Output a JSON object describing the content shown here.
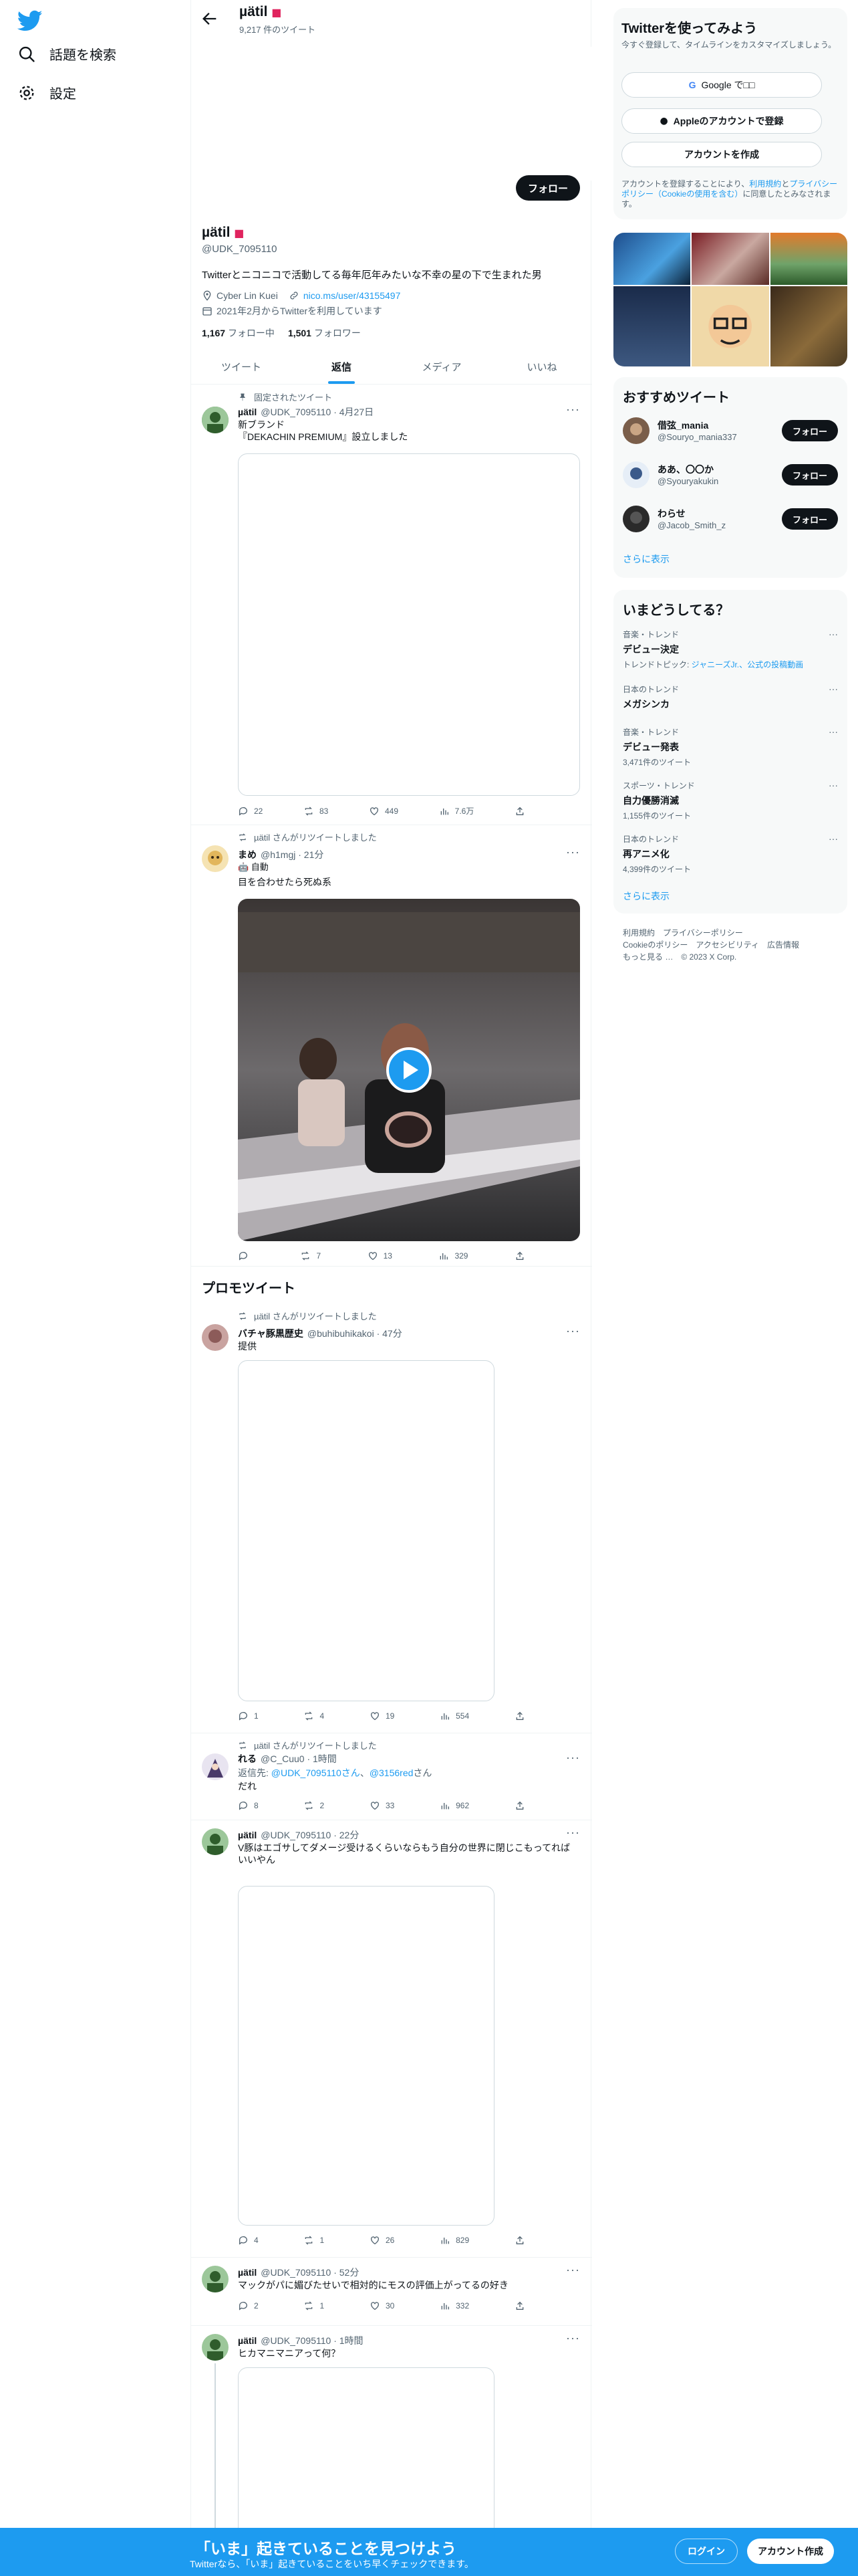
{
  "nav": {
    "logo_icon": "twitter-bird-icon",
    "items": [
      {
        "label": "話題を検索",
        "icon": "search-icon"
      },
      {
        "label": "設定",
        "icon": "gear-icon"
      }
    ]
  },
  "header": {
    "name": "µätil",
    "tweet_count": "9,217 件のツイート"
  },
  "profile": {
    "follow_label": "フォロー",
    "name": "µätil",
    "handle": "@UDK_7095110",
    "bio": "Twitterとニコニコで活動してる毎年厄年みたいな不幸の星の下で生まれた男",
    "location": "Cyber Lin Kuei",
    "url": "nico.ms/user/43155497",
    "joined": "2021年2月からTwitterを利用しています",
    "following_num": "1,167",
    "following_label": "フォロー中",
    "followers_num": "1,501",
    "followers_label": "フォロワー"
  },
  "tabs": [
    "ツイート",
    "返信",
    "メディア",
    "いいね"
  ],
  "tweets": [
    {
      "context": "固定されたツイート",
      "name": "µätil",
      "handle": "@UDK_7095110 · 4月27日",
      "text": "新ブランド\n『DEKACHIN PREMIUM』設立しました",
      "reply": "22",
      "rt": "83",
      "like": "449",
      "views": "7.6万"
    },
    {
      "context": "µätil さんがリツイートしました",
      "name": "まめ",
      "handle": "@h1mgj · 21分",
      "badge": "🤖 自動",
      "text": "目を合わせたら死ぬ系",
      "reply": "",
      "rt": "7",
      "like": "13",
      "views": "329"
    },
    {
      "context": "µätil さんがリツイートしました",
      "name": "バチャ豚黒歴史",
      "handle": "@buhibuhikakoi · 47分",
      "text": "提供",
      "reply": "1",
      "rt": "4",
      "like": "19",
      "views": "554"
    },
    {
      "context": "µätil さんがリツイートしました",
      "name": "れる",
      "handle": "@C_Cuu0 · 1時間",
      "reply_to_prefix": "返信先: ",
      "reply_to_a": "@UDK_7095110さん",
      "reply_to_mid": "、",
      "reply_to_b": "@3156red",
      "reply_to_suffix": "さん",
      "text": "だれ",
      "reply": "8",
      "rt": "2",
      "like": "33",
      "views": "962"
    },
    {
      "name": "µätil",
      "handle": "@UDK_7095110 · 22分",
      "text": "V豚はエゴサしてダメージ受けるくらいならもう自分の世界に閉じこもってればいいやん",
      "reply": "4",
      "rt": "1",
      "like": "26",
      "views": "829"
    },
    {
      "name": "µätil",
      "handle": "@UDK_7095110 · 52分",
      "text": "マックがパに媚びたせいで相対的にモスの評価上がってるの好き",
      "reply": "2",
      "rt": "1",
      "like": "30",
      "views": "332"
    },
    {
      "name": "µätil",
      "handle": "@UDK_7095110 · 1時間",
      "text": "ヒカマニマニアって何？"
    }
  ],
  "promo_heading": "プロモツイート",
  "right": {
    "signup": {
      "title": "Twitterを使ってみよう",
      "desc": "今すぐ登録して、タイムラインをカスタマイズしましょう。",
      "google": "Google で□□",
      "apple": "Appleのアカウントで登録",
      "create": "アカウントを作成",
      "legal_a": "アカウントを登録することにより、",
      "legal_link1": "利用規約",
      "legal_b": "と",
      "legal_link2": "プライバシーポリシー（Cookieの使用を含む）",
      "legal_c": "に同意したとみなされます。"
    },
    "recs": {
      "title": "おすすめツイート",
      "items": [
        {
          "name": "借弦_mania",
          "handle": "@Souryo_mania337",
          "btn": "フォロー"
        },
        {
          "name": "ああ、〇〇か",
          "handle": "@Syouryakukin",
          "btn": "フォロー"
        },
        {
          "name": "わらせ",
          "handle": "@Jacob_Smith_z",
          "btn": "フォロー"
        }
      ],
      "show_more": "さらに表示"
    },
    "trends": {
      "title": "いまどうしてる？",
      "items": [
        {
          "cat": "音楽・トレンド",
          "name": "デビュー決定",
          "sub_prefix": "トレンドトピック: ",
          "sub_link": "ジャニーズJr.、公式の投稿動画"
        },
        {
          "cat": "日本のトレンド",
          "name": "メガシンカ",
          "count": ""
        },
        {
          "cat": "音楽・トレンド",
          "name": "デビュー発表",
          "count": "3,471件のツイート"
        },
        {
          "cat": "スポーツ・トレンド",
          "name": "自力優勝消滅",
          "count": "1,155件のツイート"
        },
        {
          "cat": "日本のトレンド",
          "name": "再アニメ化",
          "count": "4,399件のツイート"
        }
      ],
      "show_more": "さらに表示"
    },
    "footer": {
      "line1": "利用規約　プライバシーポリシー",
      "line2": "Cookieのポリシー　アクセシビリティ　広告情報",
      "line3": "もっと見る …　© 2023 X Corp."
    }
  },
  "bottombar": {
    "title": "「いま」起きていることを見つけよう",
    "subtitle": "Twitterなら、「いま」起きていることをいち早くチェックできます。",
    "login": "ログイン",
    "signup": "アカウント作成"
  },
  "colors": {
    "accent": "#1d9bf0",
    "text": "#0f1419",
    "muted": "#536471"
  }
}
